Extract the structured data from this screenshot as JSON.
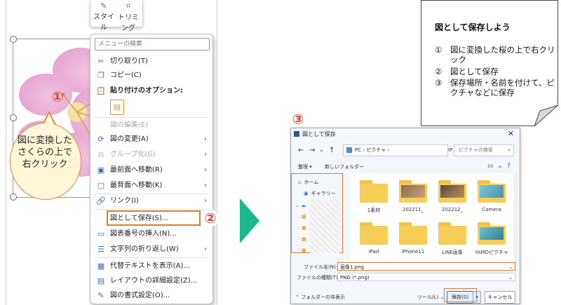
{
  "ribbon": {
    "style_label": "スタイル",
    "crop_label": "トリミング"
  },
  "menu": {
    "search_placeholder": "メニューの検索",
    "items": [
      {
        "label": "切り取り(T)",
        "icon": "scissors-icon",
        "disabled": false,
        "arrow": false
      },
      {
        "label": "コピー(C)",
        "icon": "copy-icon",
        "disabled": false,
        "arrow": false
      },
      {
        "label": "貼り付けのオプション:",
        "icon": "paste-icon",
        "disabled": false,
        "arrow": false,
        "bold": true
      },
      {
        "label": "図の編集(E)",
        "icon": "edit-picture-icon",
        "disabled": true,
        "arrow": false
      },
      {
        "label": "図の変更(A)",
        "icon": "change-picture-icon",
        "disabled": false,
        "arrow": true
      },
      {
        "label": "グループ化(G)",
        "icon": "group-icon",
        "disabled": true,
        "arrow": true
      },
      {
        "label": "最前面へ移動(R)",
        "icon": "bring-front-icon",
        "disabled": false,
        "arrow": true
      },
      {
        "label": "最背面へ移動(K)",
        "icon": "send-back-icon",
        "disabled": false,
        "arrow": true
      },
      {
        "label": "リンク(I)",
        "icon": "link-icon",
        "disabled": false,
        "arrow": true
      },
      {
        "label": "図として保存(S)...",
        "icon": "",
        "disabled": false,
        "arrow": false
      },
      {
        "label": "図表番号の挿入(N)...",
        "icon": "caption-icon",
        "disabled": false,
        "arrow": false
      },
      {
        "label": "文字列の折り返し(W)",
        "icon": "wrap-text-icon",
        "disabled": false,
        "arrow": true
      },
      {
        "label": "代替テキストを表示(A)...",
        "icon": "alt-text-icon",
        "disabled": false,
        "arrow": false
      },
      {
        "label": "レイアウトの詳細設定(Z)...",
        "icon": "layout-icon",
        "disabled": false,
        "arrow": false
      },
      {
        "label": "図の書式設定(O)...",
        "icon": "format-picture-icon",
        "disabled": false,
        "arrow": false
      }
    ]
  },
  "markers": {
    "one": "①",
    "two": "②",
    "three": "③"
  },
  "bubble": {
    "text": "図に変換した\nさくらの上で\n右クリック"
  },
  "note": {
    "title": "図として保存しよう",
    "steps": [
      {
        "n": "①",
        "t": "図に変換した桜の上で右クリック"
      },
      {
        "n": "②",
        "t": "図として保存"
      },
      {
        "n": "③",
        "t": "保存場所・名前を付けて、ピクチャなどに保存"
      }
    ]
  },
  "dialog": {
    "title": "図として保存",
    "close": "✕",
    "address": "PC  ›  ピクチャ  ›",
    "search_placeholder": "ピクチャの検索",
    "organize": "整理 ▾",
    "new_folder": "新しいフォルダー",
    "sidebar": [
      {
        "label": "ホーム"
      },
      {
        "label": "ギャラリー"
      }
    ],
    "files": [
      {
        "name": "1素材",
        "photo": false
      },
      {
        "name": "202211_",
        "photo": true
      },
      {
        "name": "202212_",
        "photo": true
      },
      {
        "name": "Camera",
        "photo": true
      },
      {
        "name": "iPad",
        "photo": false
      },
      {
        "name": "iPhone11",
        "photo": false
      },
      {
        "name": "LINE画像",
        "photo": false
      },
      {
        "name": "YAMDピクチャ",
        "photo": true
      }
    ],
    "filename_label": "ファイル名(N):",
    "filename_value": "画像1.png",
    "filetype_label": "ファイルの種類(T):",
    "filetype_value": "PNG (*.png)",
    "hide_folders": "フォルダーの非表示",
    "tools": "ツール(L)",
    "save": "保存(S)",
    "cancel": "キャンセル"
  }
}
